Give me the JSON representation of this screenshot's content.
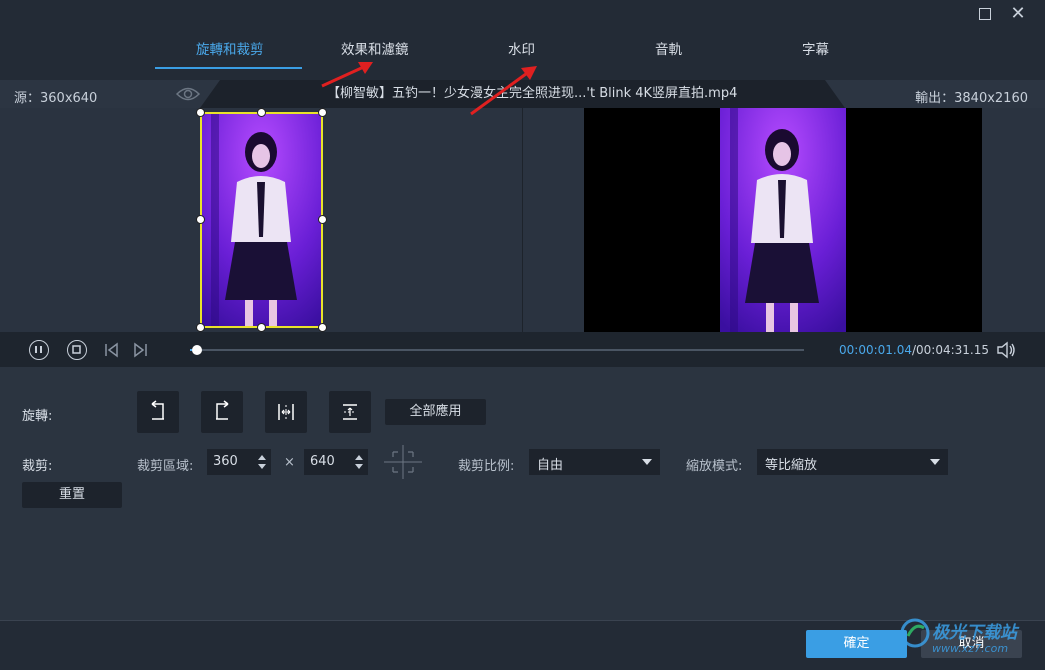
{
  "tabs": [
    {
      "label": "旋轉和裁剪",
      "active": true
    },
    {
      "label": "效果和濾鏡",
      "active": false
    },
    {
      "label": "水印",
      "active": false
    },
    {
      "label": "音軌",
      "active": false
    },
    {
      "label": "字幕",
      "active": false
    }
  ],
  "info": {
    "source": "源：360x640",
    "filename": "【柳智敏】五钓一！少女漫女主完全照进现...'t Blink 4K竖屏直拍.mp4",
    "output": "輸出：3840x2160"
  },
  "player": {
    "current_time": "00:00:01.04",
    "separator": "/",
    "total_time": "00:04:31.15",
    "progress": 0.004
  },
  "rotate": {
    "label": "旋轉:",
    "apply_all": "全部應用"
  },
  "crop": {
    "label": "裁剪:",
    "area_label": "裁剪區域:",
    "width": "360",
    "times": "×",
    "height": "640",
    "ratio_label": "裁剪比例:",
    "ratio_value": "自由",
    "zoom_label": "縮放模式:",
    "zoom_value": "等比縮放",
    "reset": "重置"
  },
  "footer": {
    "ok": "確定",
    "cancel": "取消"
  },
  "watermark": {
    "name": "极光下载站",
    "url": "www.xz7.com"
  },
  "colors": {
    "accent": "#3a9ee4",
    "crop_border": "#e9e32a",
    "annotation_arrow": "#e02020"
  }
}
